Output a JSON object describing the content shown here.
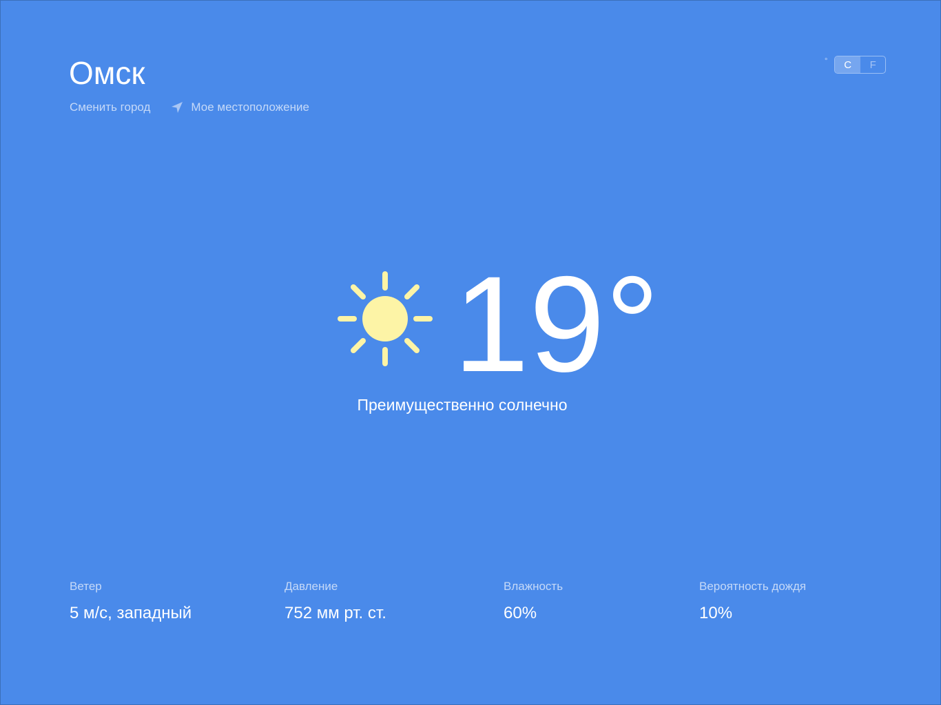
{
  "header": {
    "city": "Омск",
    "change_city_label": "Сменить город",
    "my_location_label": "Мое местоположение"
  },
  "units": {
    "degree_symbol": "°",
    "options": [
      "C",
      "F"
    ],
    "selected": "C"
  },
  "current": {
    "icon": "sun-icon",
    "temperature": "19°",
    "condition": "Преимущественно солнечно"
  },
  "stats": [
    {
      "label": "Ветер",
      "value": "5 м/с, западный"
    },
    {
      "label": "Давление",
      "value": "752 мм рт. ст."
    },
    {
      "label": "Влажность",
      "value": "60%"
    },
    {
      "label": "Вероятность дождя",
      "value": "10%"
    }
  ],
  "colors": {
    "background": "#4a8aea",
    "sun": "#fdf4a6",
    "secondary_text": "#c5d9f8"
  }
}
